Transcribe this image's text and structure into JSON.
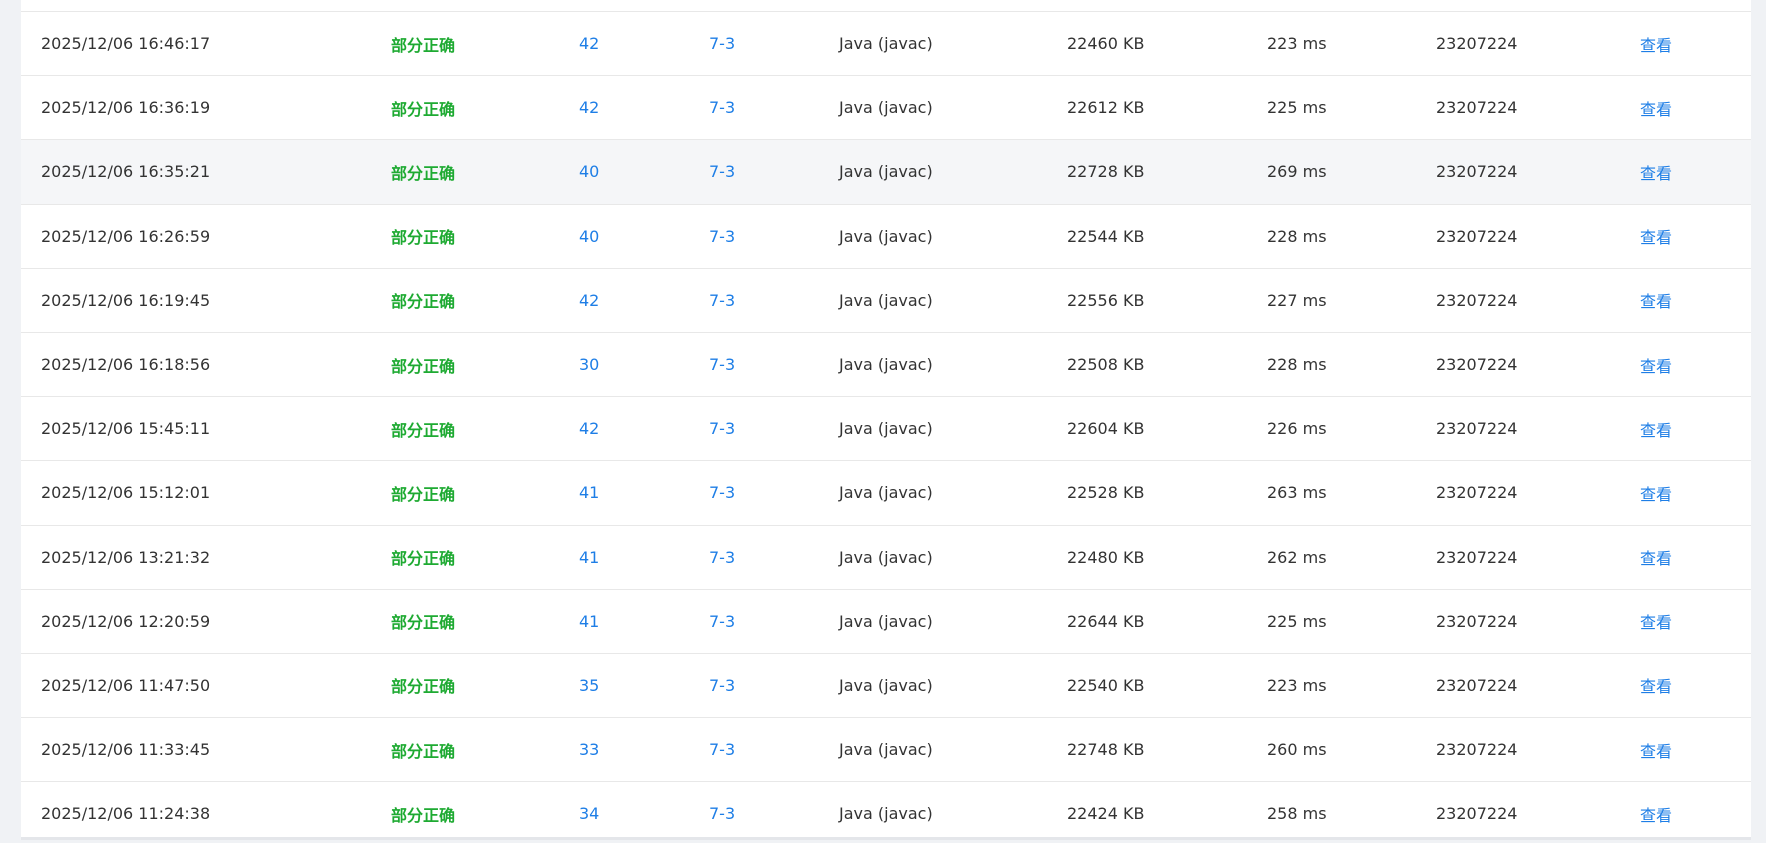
{
  "submissions": {
    "view_label": "查看",
    "rows": [
      {
        "time": "2025/12/06 16:46:17",
        "status": "部分正确",
        "score": "42",
        "problem": "7-3",
        "lang": "Java (javac)",
        "mem": "22460 KB",
        "time_used": "223 ms",
        "user": "23207224"
      },
      {
        "time": "2025/12/06 16:36:19",
        "status": "部分正确",
        "score": "42",
        "problem": "7-3",
        "lang": "Java (javac)",
        "mem": "22612 KB",
        "time_used": "225 ms",
        "user": "23207224"
      },
      {
        "time": "2025/12/06 16:35:21",
        "status": "部分正确",
        "score": "40",
        "problem": "7-3",
        "lang": "Java (javac)",
        "mem": "22728 KB",
        "time_used": "269 ms",
        "user": "23207224"
      },
      {
        "time": "2025/12/06 16:26:59",
        "status": "部分正确",
        "score": "40",
        "problem": "7-3",
        "lang": "Java (javac)",
        "mem": "22544 KB",
        "time_used": "228 ms",
        "user": "23207224"
      },
      {
        "time": "2025/12/06 16:19:45",
        "status": "部分正确",
        "score": "42",
        "problem": "7-3",
        "lang": "Java (javac)",
        "mem": "22556 KB",
        "time_used": "227 ms",
        "user": "23207224"
      },
      {
        "time": "2025/12/06 16:18:56",
        "status": "部分正确",
        "score": "30",
        "problem": "7-3",
        "lang": "Java (javac)",
        "mem": "22508 KB",
        "time_used": "228 ms",
        "user": "23207224"
      },
      {
        "time": "2025/12/06 15:45:11",
        "status": "部分正确",
        "score": "42",
        "problem": "7-3",
        "lang": "Java (javac)",
        "mem": "22604 KB",
        "time_used": "226 ms",
        "user": "23207224"
      },
      {
        "time": "2025/12/06 15:12:01",
        "status": "部分正确",
        "score": "41",
        "problem": "7-3",
        "lang": "Java (javac)",
        "mem": "22528 KB",
        "time_used": "263 ms",
        "user": "23207224"
      },
      {
        "time": "2025/12/06 13:21:32",
        "status": "部分正确",
        "score": "41",
        "problem": "7-3",
        "lang": "Java (javac)",
        "mem": "22480 KB",
        "time_used": "262 ms",
        "user": "23207224"
      },
      {
        "time": "2025/12/06 12:20:59",
        "status": "部分正确",
        "score": "41",
        "problem": "7-3",
        "lang": "Java (javac)",
        "mem": "22644 KB",
        "time_used": "225 ms",
        "user": "23207224"
      },
      {
        "time": "2025/12/06 11:47:50",
        "status": "部分正确",
        "score": "35",
        "problem": "7-3",
        "lang": "Java (javac)",
        "mem": "22540 KB",
        "time_used": "223 ms",
        "user": "23207224"
      },
      {
        "time": "2025/12/06 11:33:45",
        "status": "部分正确",
        "score": "33",
        "problem": "7-3",
        "lang": "Java (javac)",
        "mem": "22748 KB",
        "time_used": "260 ms",
        "user": "23207224"
      },
      {
        "time": "2025/12/06 11:24:38",
        "status": "部分正确",
        "score": "34",
        "problem": "7-3",
        "lang": "Java (javac)",
        "mem": "22424 KB",
        "time_used": "258 ms",
        "user": "23207224"
      }
    ]
  },
  "colors": {
    "status_partial": "#1eaa32",
    "link": "#1e7ee6",
    "text": "#333333",
    "row_hover": "#f5f6f8"
  }
}
